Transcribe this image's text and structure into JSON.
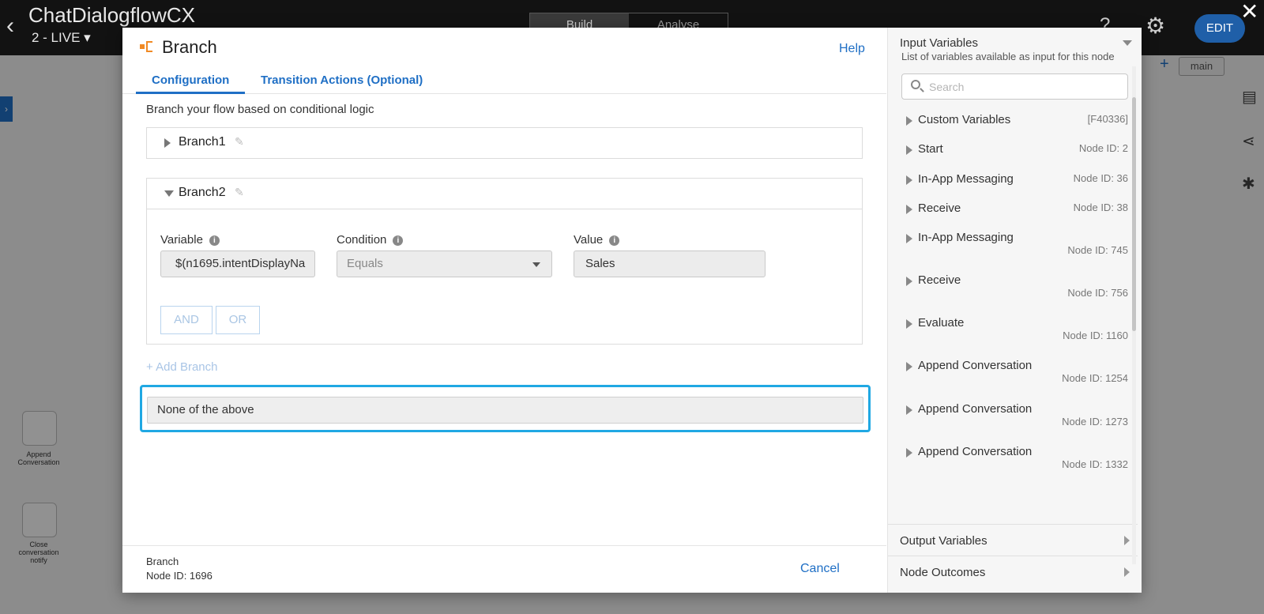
{
  "app": {
    "title": "ChatDialogflowCX",
    "version": "2 - LIVE",
    "mode_tabs": [
      "Build",
      "Analyse"
    ],
    "help": "?",
    "edit_label": "EDIT",
    "canvas_tab": "main",
    "close": "✕"
  },
  "modal": {
    "title": "Branch",
    "help_label": "Help",
    "tabs": [
      {
        "label": "Configuration",
        "active": true
      },
      {
        "label": "Transition Actions (Optional)",
        "active": false
      }
    ],
    "intro": "Branch your flow based on conditional logic",
    "branches": [
      {
        "name": "Branch1",
        "expanded": false
      },
      {
        "name": "Branch2",
        "expanded": true,
        "condition": {
          "variable_label": "Variable",
          "variable_value": "$(n1695.intentDisplayNa",
          "condition_label": "Condition",
          "condition_value": "Equals",
          "value_label": "Value",
          "value_value": "Sales"
        },
        "logic_buttons": [
          "AND",
          "OR"
        ]
      }
    ],
    "add_branch": "+ Add Branch",
    "default_branch": "None of the above",
    "footer": {
      "node_type": "Branch",
      "node_id": "Node ID: 1696",
      "cancel": "Cancel"
    }
  },
  "right_panel": {
    "title": "Input Variables",
    "subtitle": "List of variables available as input for this node",
    "search_placeholder": "Search",
    "items": [
      {
        "name": "Custom Variables",
        "id": "[F40336]"
      },
      {
        "name": "Start",
        "id": "Node ID: 2"
      },
      {
        "name": "In-App Messaging",
        "id": "Node ID: 36"
      },
      {
        "name": "Receive",
        "id": "Node ID: 38"
      },
      {
        "name": "In-App Messaging",
        "id": "Node ID: 745"
      },
      {
        "name": "Receive",
        "id": "Node ID: 756"
      },
      {
        "name": "Evaluate",
        "id": "Node ID: 1160"
      },
      {
        "name": "Append Conversation",
        "id": "Node ID: 1254"
      },
      {
        "name": "Append Conversation",
        "id": "Node ID: 1273"
      },
      {
        "name": "Append Conversation",
        "id": "Node ID: 1332"
      }
    ],
    "output_variables": "Output Variables",
    "node_outcomes": "Node Outcomes"
  },
  "canvas": {
    "node_labels": [
      "Append Conversation",
      "Close conversation notify"
    ]
  },
  "colors": {
    "accent": "#1f6fc5",
    "highlight_border": "#20a8e3",
    "branch_icon": "#f08a24",
    "topbar": "#121212"
  }
}
